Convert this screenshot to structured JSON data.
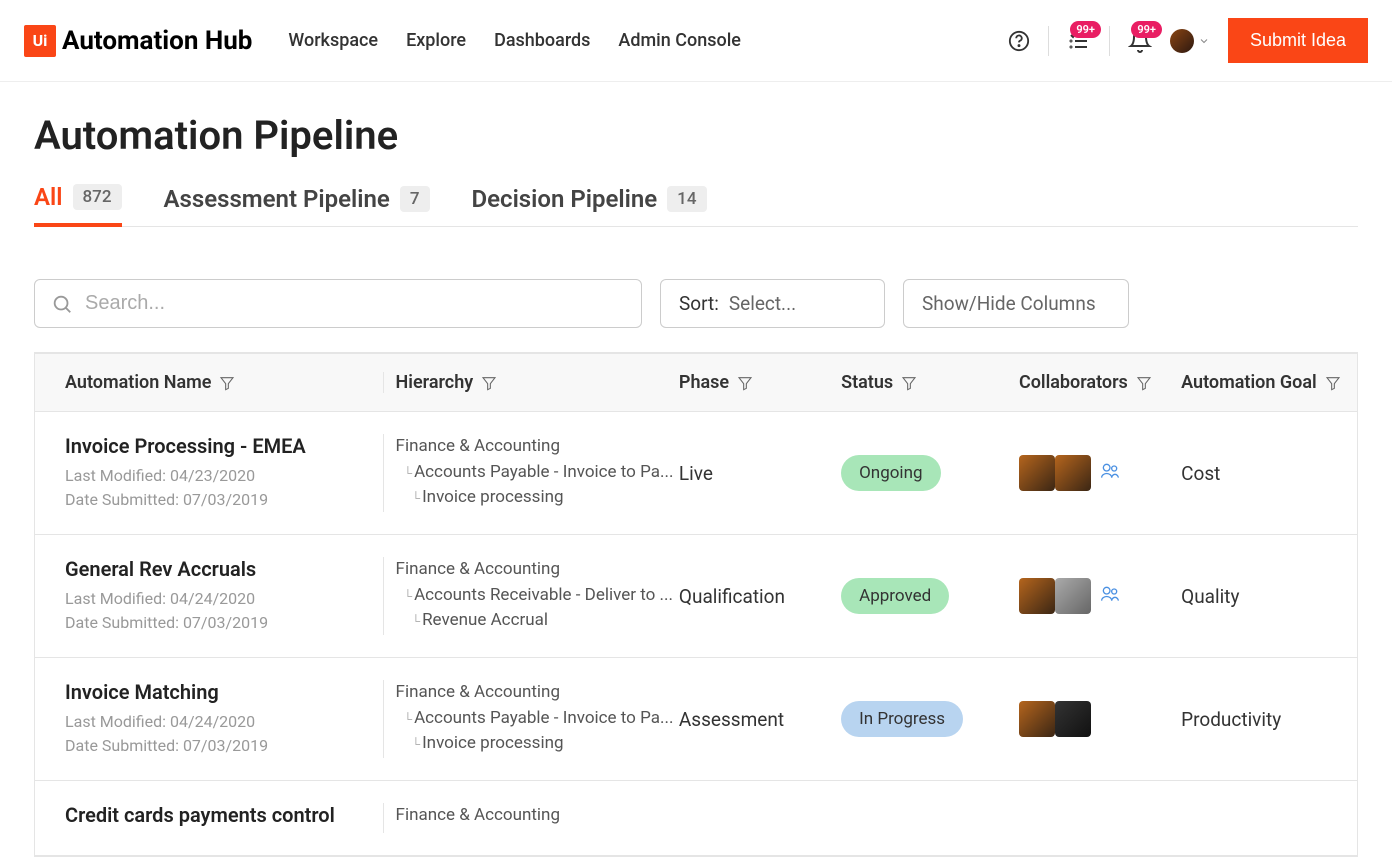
{
  "brand": {
    "logo_short": "Ui",
    "name": "Automation Hub"
  },
  "nav": {
    "items": [
      "Workspace",
      "Explore",
      "Dashboards",
      "Admin Console"
    ]
  },
  "header": {
    "tasks_badge": "99+",
    "notif_badge": "99+",
    "submit_label": "Submit Idea"
  },
  "page": {
    "title": "Automation Pipeline"
  },
  "tabs": [
    {
      "label": "All",
      "count": "872",
      "active": true
    },
    {
      "label": "Assessment Pipeline",
      "count": "7",
      "active": false
    },
    {
      "label": "Decision Pipeline",
      "count": "14",
      "active": false
    }
  ],
  "controls": {
    "search_placeholder": "Search...",
    "sort_label": "Sort:",
    "sort_value": "Select...",
    "columns_label": "Show/Hide Columns"
  },
  "columns": {
    "name": "Automation Name",
    "hierarchy": "Hierarchy",
    "phase": "Phase",
    "status": "Status",
    "collaborators": "Collaborators",
    "goal": "Automation Goal"
  },
  "labels": {
    "last_modified": "Last Modified:",
    "date_submitted": "Date Submitted:"
  },
  "rows": [
    {
      "name": "Invoice Processing - EMEA",
      "last_modified": "04/23/2020",
      "date_submitted": "07/03/2019",
      "hier1": "Finance & Accounting",
      "hier2": "Accounts Payable - Invoice to Pa...",
      "hier3": "Invoice processing",
      "phase": "Live",
      "status": "Ongoing",
      "status_class": "status-green",
      "goal": "Cost",
      "collab_count": 2,
      "collab_more": true
    },
    {
      "name": "General Rev Accruals",
      "last_modified": "04/24/2020",
      "date_submitted": "07/03/2019",
      "hier1": "Finance & Accounting",
      "hier2": "Accounts Receivable - Deliver to ...",
      "hier3": "Revenue Accrual",
      "phase": "Qualification",
      "status": "Approved",
      "status_class": "status-green",
      "goal": "Quality",
      "collab_count": 2,
      "collab_more": true
    },
    {
      "name": "Invoice Matching",
      "last_modified": "04/24/2020",
      "date_submitted": "07/03/2019",
      "hier1": "Finance & Accounting",
      "hier2": "Accounts Payable - Invoice to Pa...",
      "hier3": "Invoice processing",
      "phase": "Assessment",
      "status": "In Progress",
      "status_class": "status-blue",
      "goal": "Productivity",
      "collab_count": 2,
      "collab_more": false
    },
    {
      "name": "Credit cards payments control",
      "last_modified": "",
      "date_submitted": "",
      "hier1": "Finance & Accounting",
      "hier2": "",
      "hier3": "",
      "phase": "",
      "status": "",
      "status_class": "",
      "goal": "",
      "collab_count": 0,
      "collab_more": false
    }
  ]
}
